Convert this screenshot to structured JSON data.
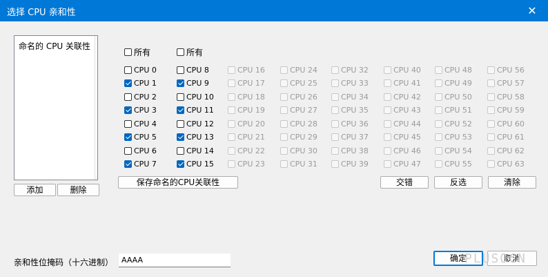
{
  "window": {
    "title": "选择 CPU 亲和性",
    "close_glyph": "✕"
  },
  "named_list": {
    "items": [
      "命名的 CPU 关联性"
    ]
  },
  "buttons": {
    "add": "添加",
    "delete": "删除",
    "save_named": "保存命名的CPU关联性",
    "intersect": "交错",
    "invert": "反选",
    "clear": "清除",
    "ok": "确定",
    "cancel": "取消"
  },
  "select_all_label": "所有",
  "columns": [
    {
      "select_all": false,
      "cpus": [
        {
          "label": "CPU 0",
          "checked": false,
          "enabled": true
        },
        {
          "label": "CPU 1",
          "checked": true,
          "enabled": true
        },
        {
          "label": "CPU 2",
          "checked": false,
          "enabled": true
        },
        {
          "label": "CPU 3",
          "checked": true,
          "enabled": true
        },
        {
          "label": "CPU 4",
          "checked": false,
          "enabled": true
        },
        {
          "label": "CPU 5",
          "checked": true,
          "enabled": true
        },
        {
          "label": "CPU 6",
          "checked": false,
          "enabled": true
        },
        {
          "label": "CPU 7",
          "checked": true,
          "enabled": true
        }
      ]
    },
    {
      "select_all": false,
      "cpus": [
        {
          "label": "CPU 8",
          "checked": false,
          "enabled": true
        },
        {
          "label": "CPU 9",
          "checked": true,
          "enabled": true
        },
        {
          "label": "CPU 10",
          "checked": false,
          "enabled": true
        },
        {
          "label": "CPU 11",
          "checked": true,
          "enabled": true
        },
        {
          "label": "CPU 12",
          "checked": false,
          "enabled": true
        },
        {
          "label": "CPU 13",
          "checked": true,
          "enabled": true
        },
        {
          "label": "CPU 14",
          "checked": false,
          "enabled": true
        },
        {
          "label": "CPU 15",
          "checked": true,
          "enabled": true
        }
      ]
    },
    {
      "cpus": [
        {
          "label": "CPU 16",
          "checked": false,
          "enabled": false
        },
        {
          "label": "CPU 17",
          "checked": false,
          "enabled": false
        },
        {
          "label": "CPU 18",
          "checked": false,
          "enabled": false
        },
        {
          "label": "CPU 19",
          "checked": false,
          "enabled": false
        },
        {
          "label": "CPU 20",
          "checked": false,
          "enabled": false
        },
        {
          "label": "CPU 21",
          "checked": false,
          "enabled": false
        },
        {
          "label": "CPU 22",
          "checked": false,
          "enabled": false
        },
        {
          "label": "CPU 23",
          "checked": false,
          "enabled": false
        }
      ]
    },
    {
      "cpus": [
        {
          "label": "CPU 24",
          "checked": false,
          "enabled": false
        },
        {
          "label": "CPU 25",
          "checked": false,
          "enabled": false
        },
        {
          "label": "CPU 26",
          "checked": false,
          "enabled": false
        },
        {
          "label": "CPU 27",
          "checked": false,
          "enabled": false
        },
        {
          "label": "CPU 28",
          "checked": false,
          "enabled": false
        },
        {
          "label": "CPU 29",
          "checked": false,
          "enabled": false
        },
        {
          "label": "CPU 30",
          "checked": false,
          "enabled": false
        },
        {
          "label": "CPU 31",
          "checked": false,
          "enabled": false
        }
      ]
    },
    {
      "cpus": [
        {
          "label": "CPU 32",
          "checked": false,
          "enabled": false
        },
        {
          "label": "CPU 33",
          "checked": false,
          "enabled": false
        },
        {
          "label": "CPU 34",
          "checked": false,
          "enabled": false
        },
        {
          "label": "CPU 35",
          "checked": false,
          "enabled": false
        },
        {
          "label": "CPU 36",
          "checked": false,
          "enabled": false
        },
        {
          "label": "CPU 37",
          "checked": false,
          "enabled": false
        },
        {
          "label": "CPU 38",
          "checked": false,
          "enabled": false
        },
        {
          "label": "CPU 39",
          "checked": false,
          "enabled": false
        }
      ]
    },
    {
      "cpus": [
        {
          "label": "CPU 40",
          "checked": false,
          "enabled": false
        },
        {
          "label": "CPU 41",
          "checked": false,
          "enabled": false
        },
        {
          "label": "CPU 42",
          "checked": false,
          "enabled": false
        },
        {
          "label": "CPU 43",
          "checked": false,
          "enabled": false
        },
        {
          "label": "CPU 44",
          "checked": false,
          "enabled": false
        },
        {
          "label": "CPU 45",
          "checked": false,
          "enabled": false
        },
        {
          "label": "CPU 46",
          "checked": false,
          "enabled": false
        },
        {
          "label": "CPU 47",
          "checked": false,
          "enabled": false
        }
      ]
    },
    {
      "cpus": [
        {
          "label": "CPU 48",
          "checked": false,
          "enabled": false
        },
        {
          "label": "CPU 49",
          "checked": false,
          "enabled": false
        },
        {
          "label": "CPU 50",
          "checked": false,
          "enabled": false
        },
        {
          "label": "CPU 51",
          "checked": false,
          "enabled": false
        },
        {
          "label": "CPU 52",
          "checked": false,
          "enabled": false
        },
        {
          "label": "CPU 53",
          "checked": false,
          "enabled": false
        },
        {
          "label": "CPU 54",
          "checked": false,
          "enabled": false
        },
        {
          "label": "CPU 55",
          "checked": false,
          "enabled": false
        }
      ]
    },
    {
      "cpus": [
        {
          "label": "CPU 56",
          "checked": false,
          "enabled": false
        },
        {
          "label": "CPU 57",
          "checked": false,
          "enabled": false
        },
        {
          "label": "CPU 58",
          "checked": false,
          "enabled": false
        },
        {
          "label": "CPU 59",
          "checked": false,
          "enabled": false
        },
        {
          "label": "CPU 60",
          "checked": false,
          "enabled": false
        },
        {
          "label": "CPU 61",
          "checked": false,
          "enabled": false
        },
        {
          "label": "CPU 62",
          "checked": false,
          "enabled": false
        },
        {
          "label": "CPU 63",
          "checked": false,
          "enabled": false
        }
      ]
    }
  ],
  "mask": {
    "label": "亲和性位掩码（十六进制）",
    "value": "AAAA"
  },
  "watermark": "PLUSOCN"
}
